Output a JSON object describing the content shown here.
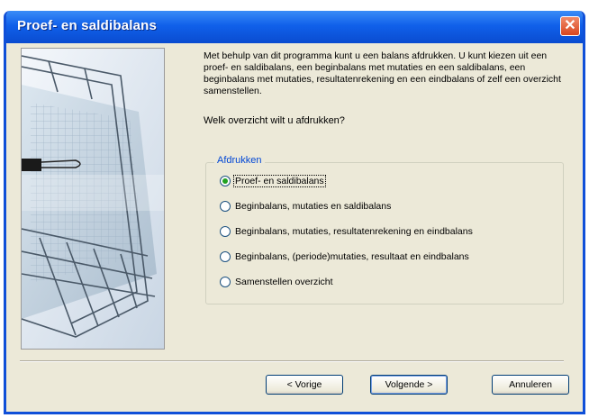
{
  "window": {
    "title": "Proef- en saldibalans"
  },
  "intro_text": "Met behulp van dit programma kunt u een balans afdrukken. U kunt kiezen uit een proef- en saldibalans, een beginbalans met mutaties en een saldibalans, een beginbalans met mutaties, resultatenrekening en een eindbalans of zelf een overzicht samenstellen.",
  "question": "Welk overzicht wilt u afdrukken?",
  "group": {
    "label": "Afdrukken",
    "options": [
      {
        "label": "Proef- en saldibalans",
        "checked": true
      },
      {
        "label": "Beginbalans, mutaties en saldibalans",
        "checked": false
      },
      {
        "label": "Beginbalans, mutaties, resultatenrekening en eindbalans",
        "checked": false
      },
      {
        "label": "Beginbalans, (periode)mutaties, resultaat en eindbalans",
        "checked": false
      },
      {
        "label": "Samenstellen overzicht",
        "checked": false
      }
    ]
  },
  "buttons": {
    "back": "< Vorige",
    "next": "Volgende >",
    "cancel": "Annuleren"
  },
  "colors": {
    "titlebar": "#0a4cd0",
    "dialog_bg": "#ece9d8",
    "group_label": "#0046d5",
    "close_button": "#d9461f"
  }
}
